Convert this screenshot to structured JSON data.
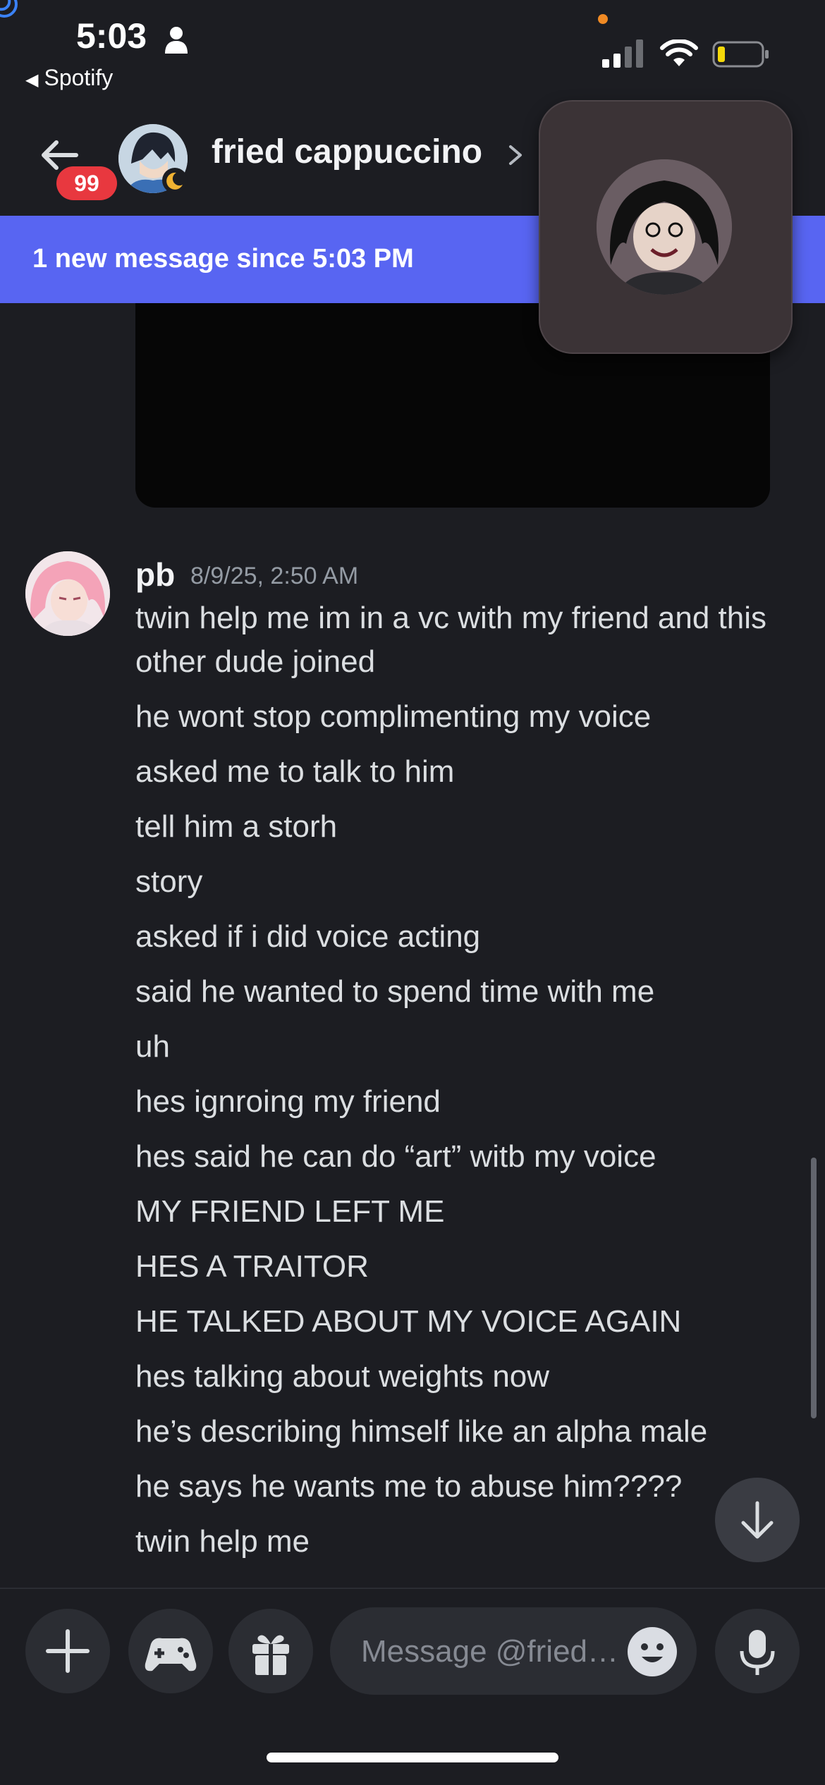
{
  "status_bar": {
    "time": "5:03",
    "back_app_label": "Spotify",
    "icons": [
      "person-icon",
      "signal-icon",
      "wifi-icon",
      "battery-icon"
    ]
  },
  "header": {
    "title": "fried cappuccino",
    "unread_badge": "99",
    "icons": [
      "back-arrow-icon",
      "chevron-right-icon",
      "moon-icon"
    ]
  },
  "banner": {
    "text": "1 new message since 5:03 PM"
  },
  "message": {
    "author": "pb",
    "timestamp": "8/9/25, 2:50 AM",
    "lines": [
      "twin help me im in a vc with my friend and this",
      "other dude joined",
      "he wont stop complimenting my voice",
      "asked me to talk to him",
      "tell him a storh",
      "story",
      "asked if i did voice acting",
      "said he wanted to spend time with me",
      "uh",
      "hes ignroing my friend",
      "hes said he can do “art” witb my voice",
      "MY FRIEND LEFT ME",
      "HES A TRAITOR",
      "HE TALKED ABOUT MY VOICE AGAIN",
      "hes talking about weights now",
      "he’s describing himself like an alpha male",
      "he says he wants me to abuse him????",
      "twin help me"
    ]
  },
  "composer": {
    "placeholder": "Message @fried…",
    "buttons": [
      "plus-icon",
      "gamepad-icon",
      "gift-icon",
      "emoji-icon",
      "microphone-icon"
    ]
  },
  "colors": {
    "background": "#1c1d22",
    "accent": "#5865f2",
    "badge": "#e8383f"
  }
}
